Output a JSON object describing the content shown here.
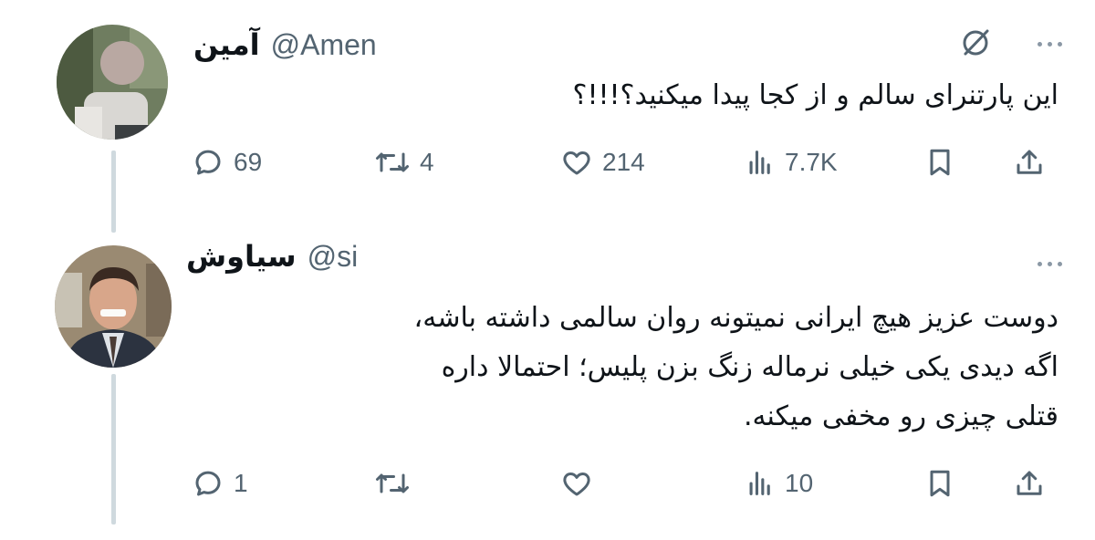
{
  "tweets": [
    {
      "display_name": "آمین",
      "handle": "@Amen",
      "text": "این پارتنرای سالم و از کجا پیدا میکنید؟!!!؟",
      "avatar_icon": "blurred-person-avatar",
      "stats": {
        "replies": "69",
        "retweets": "4",
        "likes": "214",
        "views": "7.7K"
      }
    },
    {
      "display_name": "سیاوش",
      "handle": "@si",
      "text": "دوست عزیز هیچ ایرانی نمیتونه روان سالمی داشته باشه،\nاگه دیدی یکی خیلی نرماله زنگ بزن پلیس؛ احتمالا داره\nقتلی چیزی رو مخفی میکنه.",
      "avatar_icon": "man-in-suit-avatar",
      "stats": {
        "replies": "1",
        "retweets": "",
        "likes": "",
        "views": "10"
      }
    }
  ],
  "colors": {
    "text": "#0f1419",
    "secondary": "#536471",
    "thread_line": "#cfd9de"
  }
}
